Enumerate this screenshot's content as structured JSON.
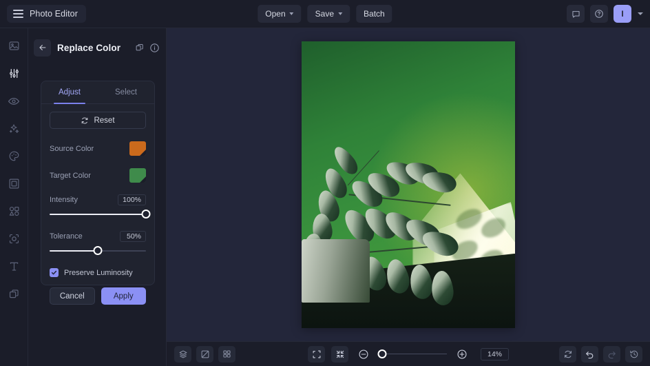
{
  "app": {
    "name": "Photo Editor",
    "menu_icon": "hamburger-icon"
  },
  "topbar": {
    "open_label": "Open",
    "save_label": "Save",
    "batch_label": "Batch",
    "comment_icon": "comment-icon",
    "help_icon": "help-circle-icon",
    "avatar_initial": "I",
    "accent_color": "#9a9ef7"
  },
  "sidebar": {
    "items": [
      {
        "name": "sidebar-item-image",
        "icon": "image-icon",
        "active": false
      },
      {
        "name": "sidebar-item-adjust",
        "icon": "sliders-icon",
        "active": true
      },
      {
        "name": "sidebar-item-retouch",
        "icon": "eye-icon",
        "active": false
      },
      {
        "name": "sidebar-item-effects",
        "icon": "sparkles-icon",
        "active": false
      },
      {
        "name": "sidebar-item-color",
        "icon": "palette-icon",
        "active": false
      },
      {
        "name": "sidebar-item-frame",
        "icon": "frame-icon",
        "active": false
      },
      {
        "name": "sidebar-item-shapes",
        "icon": "shapes-icon",
        "active": false
      },
      {
        "name": "sidebar-item-select",
        "icon": "selection-icon",
        "active": false
      },
      {
        "name": "sidebar-item-text",
        "icon": "text-icon",
        "active": false
      },
      {
        "name": "sidebar-item-layers",
        "icon": "layers-icon",
        "active": false
      }
    ]
  },
  "panel": {
    "title": "Replace Color",
    "back_icon": "arrow-left-icon",
    "duplicate_icon": "duplicate-icon",
    "info_icon": "info-icon",
    "tabs": [
      {
        "label": "Adjust",
        "active": true
      },
      {
        "label": "Select",
        "active": false
      }
    ],
    "reset_label": "Reset",
    "reset_icon": "refresh-icon",
    "source_color": {
      "label": "Source Color",
      "value": "#cb6a1c"
    },
    "target_color": {
      "label": "Target Color",
      "value": "#3f8b4b"
    },
    "intensity": {
      "label": "Intensity",
      "value": "100%",
      "percent": 100
    },
    "tolerance": {
      "label": "Tolerance",
      "value": "50%",
      "percent": 50
    },
    "preserve_luminosity": {
      "label": "Preserve Luminosity",
      "checked": true
    },
    "cancel_label": "Cancel",
    "apply_label": "Apply",
    "apply_color": "#8b90f4"
  },
  "statusbar": {
    "left_tools": [
      {
        "name": "layers-panel-button",
        "icon": "layers-icon"
      },
      {
        "name": "compare-button",
        "icon": "compare-icon"
      },
      {
        "name": "grid-view-button",
        "icon": "grid-icon"
      }
    ],
    "fit_screen_icon": "fit-screen-icon",
    "fit_content_icon": "fit-content-icon",
    "zoom_out_icon": "zoom-out-icon",
    "zoom_in_icon": "zoom-in-icon",
    "zoom_value": "14%",
    "zoom_percent": 14,
    "right_tools": [
      {
        "name": "rotate-button",
        "icon": "rotate-icon",
        "state": "enabled"
      },
      {
        "name": "undo-button",
        "icon": "undo-icon",
        "state": "enabled"
      },
      {
        "name": "redo-button",
        "icon": "redo-icon",
        "state": "disabled"
      },
      {
        "name": "history-button",
        "icon": "history-icon",
        "state": "enabled"
      }
    ]
  },
  "canvas": {
    "image_description": "ZZ plant in a pot against a green wall with diagonal sunlight"
  }
}
